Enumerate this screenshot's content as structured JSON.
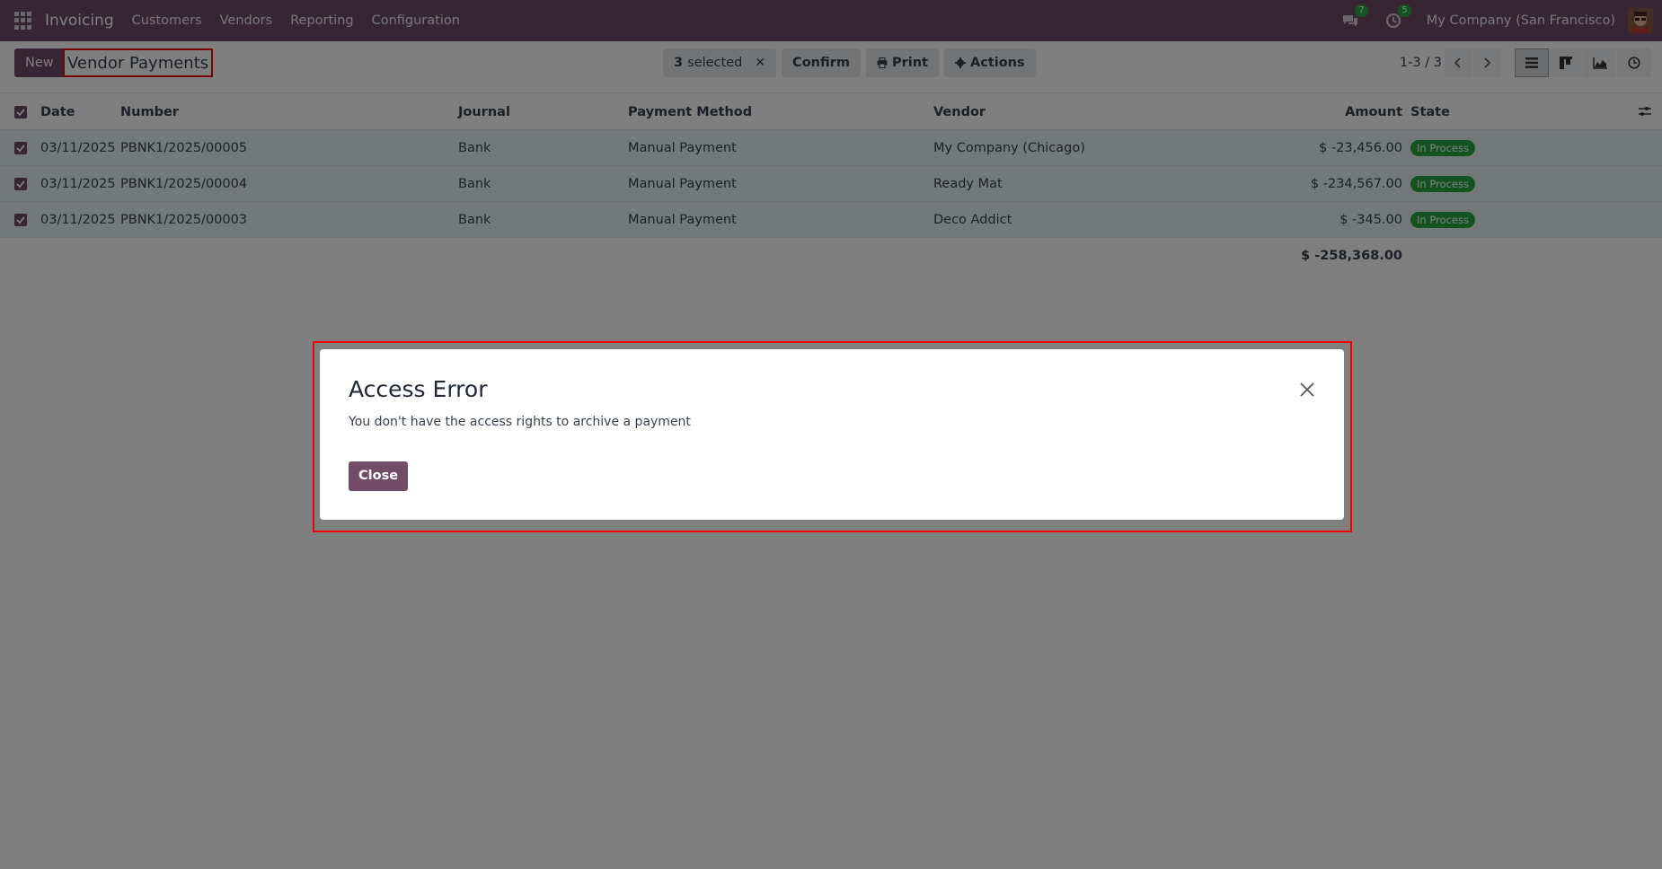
{
  "navbar": {
    "app_name": "Invoicing",
    "menu": [
      "Customers",
      "Vendors",
      "Reporting",
      "Configuration"
    ],
    "messages_count": "7",
    "activities_count": "5",
    "company": "My Company (San Francisco)",
    "brand_color": "#714b67"
  },
  "control_panel": {
    "new_label": "New",
    "title": "Vendor Payments",
    "selected_count": "3",
    "selected_label": "selected",
    "confirm_label": "Confirm",
    "print_label": "Print",
    "actions_label": "Actions",
    "pager": "1-3 / 3"
  },
  "list": {
    "columns": [
      "Date",
      "Number",
      "Journal",
      "Payment Method",
      "Vendor",
      "Amount",
      "State"
    ],
    "rows": [
      {
        "date": "03/11/2025",
        "number": "PBNK1/2025/00005",
        "journal": "Bank",
        "method": "Manual Payment",
        "vendor": "My Company (Chicago)",
        "amount": "$ -23,456.00",
        "state": "In Process"
      },
      {
        "date": "03/11/2025",
        "number": "PBNK1/2025/00004",
        "journal": "Bank",
        "method": "Manual Payment",
        "vendor": "Ready Mat",
        "amount": "$ -234,567.00",
        "state": "In Process"
      },
      {
        "date": "03/11/2025",
        "number": "PBNK1/2025/00003",
        "journal": "Bank",
        "method": "Manual Payment",
        "vendor": "Deco Addict",
        "amount": "$ -345.00",
        "state": "In Process"
      }
    ],
    "total": "$ -258,368.00"
  },
  "dialog": {
    "title": "Access Error",
    "message": "You don't have the access rights to archive a payment",
    "close_label": "Close"
  }
}
